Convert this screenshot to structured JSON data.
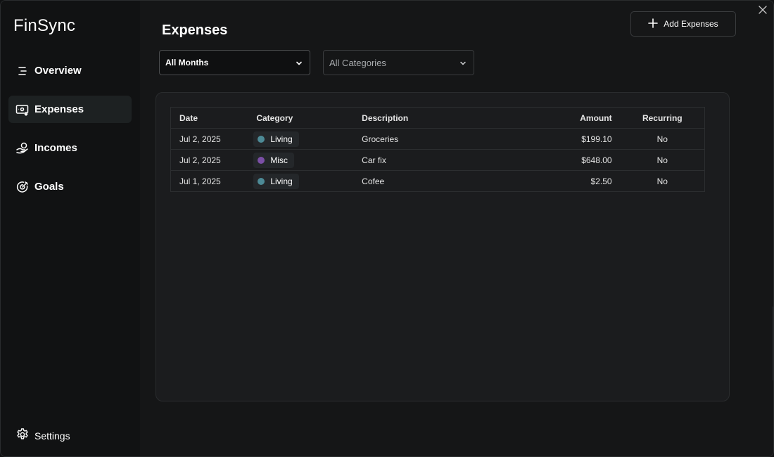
{
  "app": {
    "brand": "FinSync"
  },
  "sidebar": {
    "items": [
      {
        "id": "overview",
        "label": "Overview",
        "icon": "list-icon",
        "active": false
      },
      {
        "id": "expenses",
        "label": "Expenses",
        "icon": "wallet-icon",
        "active": true
      },
      {
        "id": "incomes",
        "label": "Incomes",
        "icon": "hand-coin-icon",
        "active": false
      },
      {
        "id": "goals",
        "label": "Goals",
        "icon": "target-icon",
        "active": false
      }
    ],
    "settings_label": "Settings"
  },
  "header": {
    "title": "Expenses",
    "add_button_label": "Add Expenses"
  },
  "filters": {
    "month": {
      "selected": "All Months"
    },
    "category": {
      "placeholder": "All Categories"
    }
  },
  "table": {
    "columns": [
      "Date",
      "Category",
      "Description",
      "Amount",
      "Recurring"
    ],
    "rows": [
      {
        "date": "Jul 2, 2025",
        "category": "Living",
        "category_color": "#4d8a96",
        "description": "Groceries",
        "amount": "$199.10",
        "recurring": "No"
      },
      {
        "date": "Jul 2, 2025",
        "category": "Misc",
        "category_color": "#7b4fa6",
        "description": "Car fix",
        "amount": "$648.00",
        "recurring": "No"
      },
      {
        "date": "Jul 1, 2025",
        "category": "Living",
        "category_color": "#4d8a96",
        "description": "Cofee",
        "amount": "$2.50",
        "recurring": "No"
      }
    ]
  },
  "colors": {
    "background": "#151617",
    "panel": "#1b1c1e",
    "active_nav": "#1d2122"
  }
}
